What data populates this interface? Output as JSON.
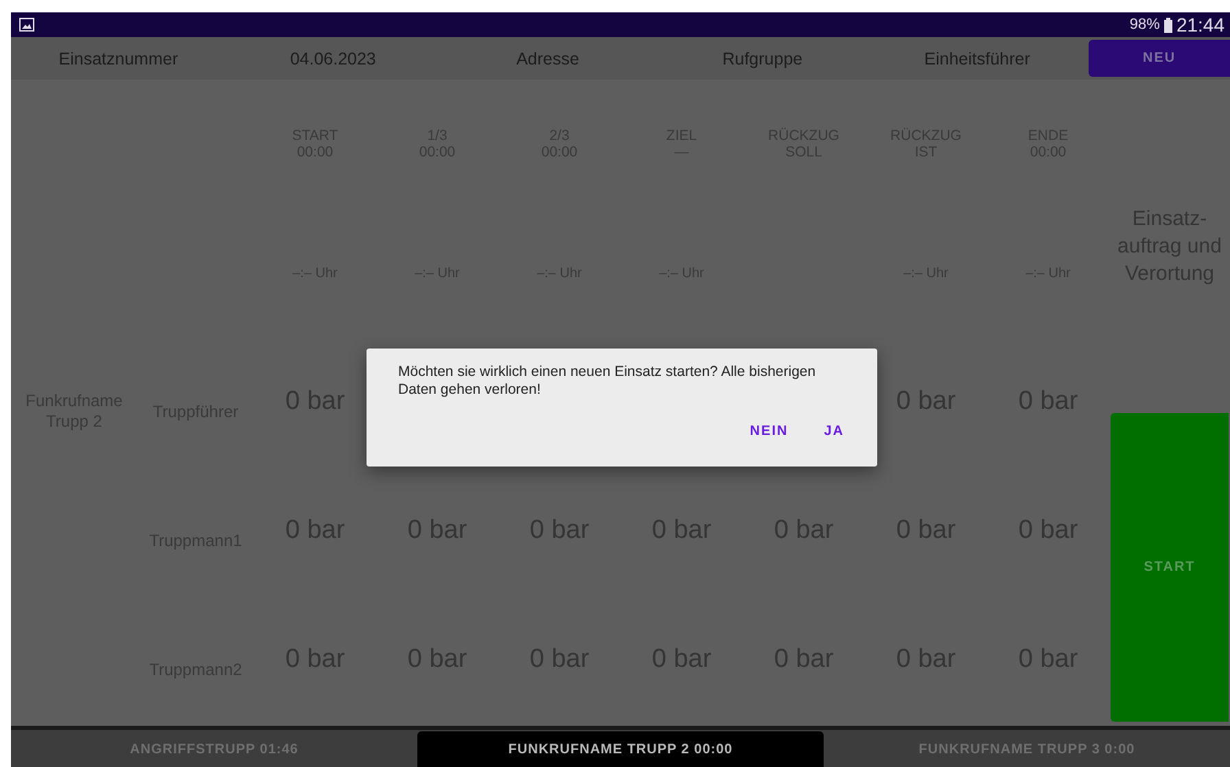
{
  "status_bar": {
    "battery": "98%",
    "time": "21:44"
  },
  "header": {
    "fields": [
      "Einsatznummer",
      "04.06.2023",
      "Adresse",
      "Rufgruppe",
      "Einheitsführer"
    ],
    "new_button": "NEU"
  },
  "columns": [
    {
      "label": "START",
      "sub": "00:00",
      "time": "–:– Uhr"
    },
    {
      "label": "1/3",
      "sub": "00:00",
      "time": "–:– Uhr"
    },
    {
      "label": "2/3",
      "sub": "00:00",
      "time": "–:– Uhr"
    },
    {
      "label": "ZIEL",
      "sub": "—",
      "time": "–:– Uhr"
    },
    {
      "label": "RÜCKZUG",
      "sub": "SOLL"
    },
    {
      "label": "RÜCKZUG",
      "sub": "IST",
      "time": "–:– Uhr"
    },
    {
      "label": "ENDE",
      "sub": "00:00",
      "time": "–:– Uhr"
    }
  ],
  "team_name": "Funkrufname Trupp 2",
  "members": [
    {
      "role": "Truppführer",
      "pressures": [
        "0 bar"
      ],
      "pressures_right": [
        "0 bar",
        "0 bar"
      ]
    },
    {
      "role": "Truppmann1",
      "pressures": [
        "0 bar",
        "0 bar",
        "0 bar",
        "0 bar",
        "0 bar",
        "0 bar",
        "0 bar"
      ]
    },
    {
      "role": "Truppmann2",
      "pressures": [
        "0 bar",
        "0 bar",
        "0 bar",
        "0 bar",
        "0 bar",
        "0 bar",
        "0 bar"
      ]
    }
  ],
  "side": {
    "label": "Einsatz-auftrag und Verortung",
    "start_button": "START"
  },
  "dialog": {
    "message": "Möchten sie wirklich einen neuen Einsatz starten? Alle bisherigen Daten gehen verloren!",
    "buttons": [
      "NEIN",
      "JA"
    ]
  },
  "tabs": [
    {
      "label": "ANGRIFFSTRUPP 01:46",
      "selected": false
    },
    {
      "label": "FUNKRUFNAME TRUPP 2 00:00",
      "selected": true
    },
    {
      "label": "FUNKRUFNAME TRUPP 3 0:00",
      "selected": false
    }
  ]
}
